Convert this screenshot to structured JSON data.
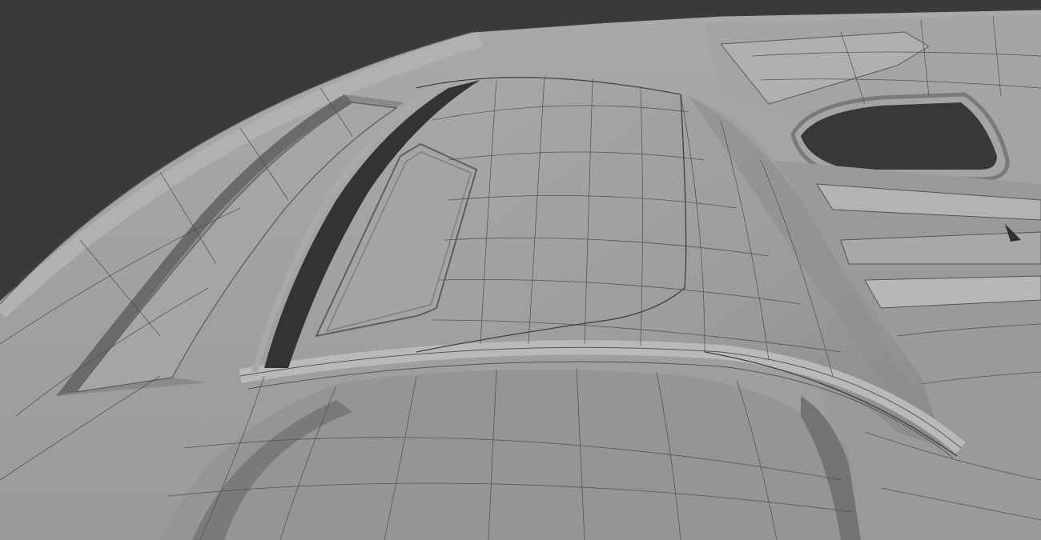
{
  "scene": {
    "render_mode": "solid-wireframe",
    "colors": {
      "background": "#3a3a3a",
      "surface_light": "#a3a3a3",
      "surface_mid": "#8f8f8f",
      "surface_shadow": "#6b6b6b",
      "cavity": "#333335",
      "wire": "#454545"
    }
  }
}
